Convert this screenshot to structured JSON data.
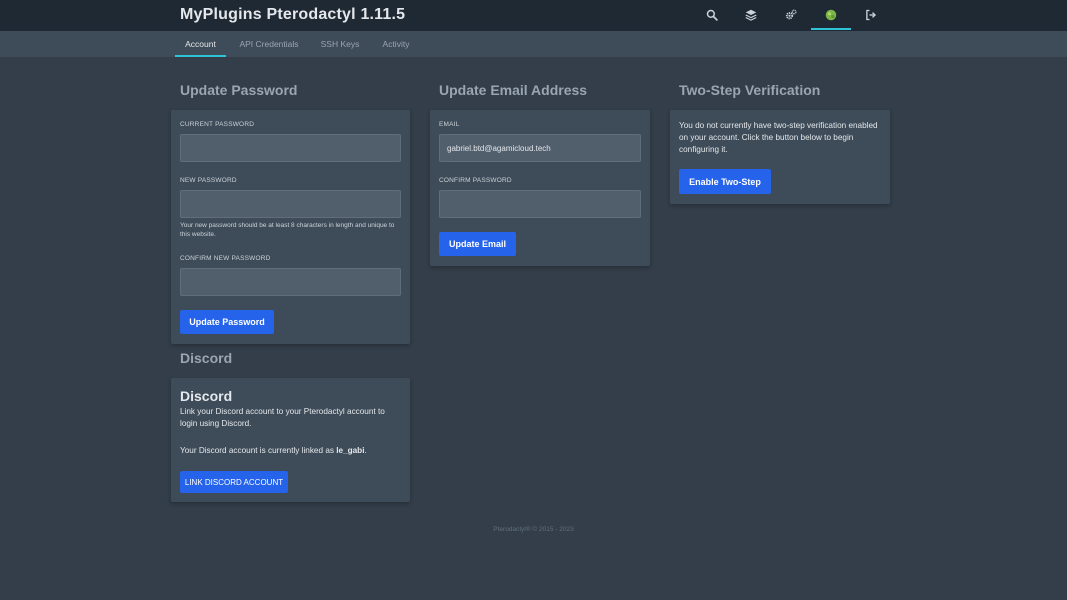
{
  "header": {
    "brand": "MyPlugins Pterodactyl 1.11.5",
    "icons": [
      "search-icon",
      "layers-icon",
      "cogs-icon",
      "avatar-icon",
      "sign-out-icon"
    ]
  },
  "tabs": [
    "Account",
    "API Credentials",
    "SSH Keys",
    "Activity"
  ],
  "password": {
    "title": "Update Password",
    "current_label": "CURRENT PASSWORD",
    "new_label": "NEW PASSWORD",
    "hint": "Your new password should be at least 8 characters in length and unique to this website.",
    "confirm_label": "CONFIRM NEW PASSWORD",
    "button": "Update Password"
  },
  "email": {
    "title": "Update Email Address",
    "email_label": "EMAIL",
    "email_value": "gabriel.btd@agamicloud.tech",
    "confirm_label": "CONFIRM PASSWORD",
    "button": "Update Email"
  },
  "twostep": {
    "title": "Two-Step Verification",
    "text": "You do not currently have two-step verification enabled on your account. Click the button below to begin configuring it.",
    "button": "Enable Two-Step"
  },
  "discord": {
    "section_title": "Discord",
    "card_title": "Discord",
    "description": "Link your Discord account to your Pterodactyl account to login using Discord.",
    "linked_prefix": "Your Discord account is currently linked as ",
    "linked_user": "le_gabi",
    "linked_suffix": ".",
    "button": "LINK DISCORD ACCOUNT"
  },
  "footer": "Pterodactyl® © 2015 - 2023",
  "colors": {
    "background": "#333e4a",
    "topbar": "#1f2933",
    "card": "#3e4c59",
    "accent": "#2ec4d6",
    "button": "#2563eb",
    "avatar": "#7ab648"
  }
}
